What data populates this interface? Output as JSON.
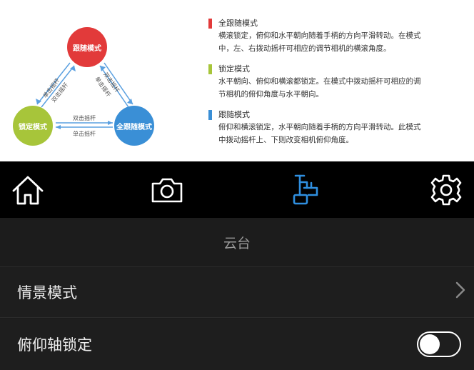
{
  "help": {
    "diagram": {
      "follow_mode": "跟随模式",
      "lock_mode": "锁定模式",
      "full_follow_mode": "全跟随模式",
      "double_click": "双击摇杆",
      "single_click": "单击摇杆"
    },
    "legend": [
      {
        "title": "全跟随模式",
        "color": "#e23a3a",
        "lines": [
          "横滚锁定，俯仰和水平朝向随着手柄的方向平滑转动。在模式",
          "中，左、右拨动摇杆可相应的调节相机的横滚角度。"
        ]
      },
      {
        "title": "锁定模式",
        "color": "#a7c53a",
        "lines": [
          "水平朝向、俯仰和横滚都锁定。在模式中拨动摇杆可相应的调",
          "节相机的俯仰角度与水平朝向。"
        ]
      },
      {
        "title": "跟随模式",
        "color": "#3a8fd6",
        "lines": [
          "俯仰和横滚锁定，水平朝向随着手柄的方向平滑转动。此模式",
          "中拨动摇杆上、下则改变相机俯仰角度。"
        ]
      }
    ]
  },
  "tabs": [
    {
      "icon": "home-icon",
      "active": false
    },
    {
      "icon": "camera-icon",
      "active": false
    },
    {
      "icon": "gimbal-icon",
      "active": true
    },
    {
      "icon": "gear-icon",
      "active": false
    }
  ],
  "colors": {
    "active_tab": "#2f8fe0",
    "inactive_tab": "#ffffff"
  },
  "settings": {
    "section_title": "云台",
    "scene_mode_label": "情景模式",
    "pitch_lock_label": "俯仰轴锁定",
    "pitch_lock_on": false
  }
}
